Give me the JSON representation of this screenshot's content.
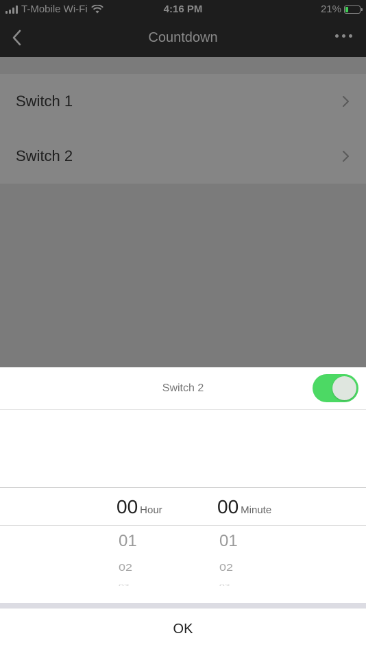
{
  "status_bar": {
    "carrier": "T-Mobile Wi-Fi",
    "time": "4:16 PM",
    "battery_percent": "21%",
    "battery_level": 0.21,
    "battery_color": "#3fcf55"
  },
  "nav": {
    "title": "Countdown",
    "back_icon": "chevron-left-icon",
    "more_icon": "more-dots-icon"
  },
  "list": {
    "items": [
      {
        "label": "Switch 1"
      },
      {
        "label": "Switch 2"
      }
    ]
  },
  "sheet": {
    "title": "Switch 2",
    "toggle_on": true,
    "toggle_color": "#4cd964",
    "picker": {
      "hour": {
        "selected": "00",
        "unit": "Hour",
        "next": [
          "01",
          "02",
          "03"
        ]
      },
      "minute": {
        "selected": "00",
        "unit": "Minute",
        "next": [
          "01",
          "02",
          "03"
        ]
      }
    },
    "ok_label": "OK"
  }
}
